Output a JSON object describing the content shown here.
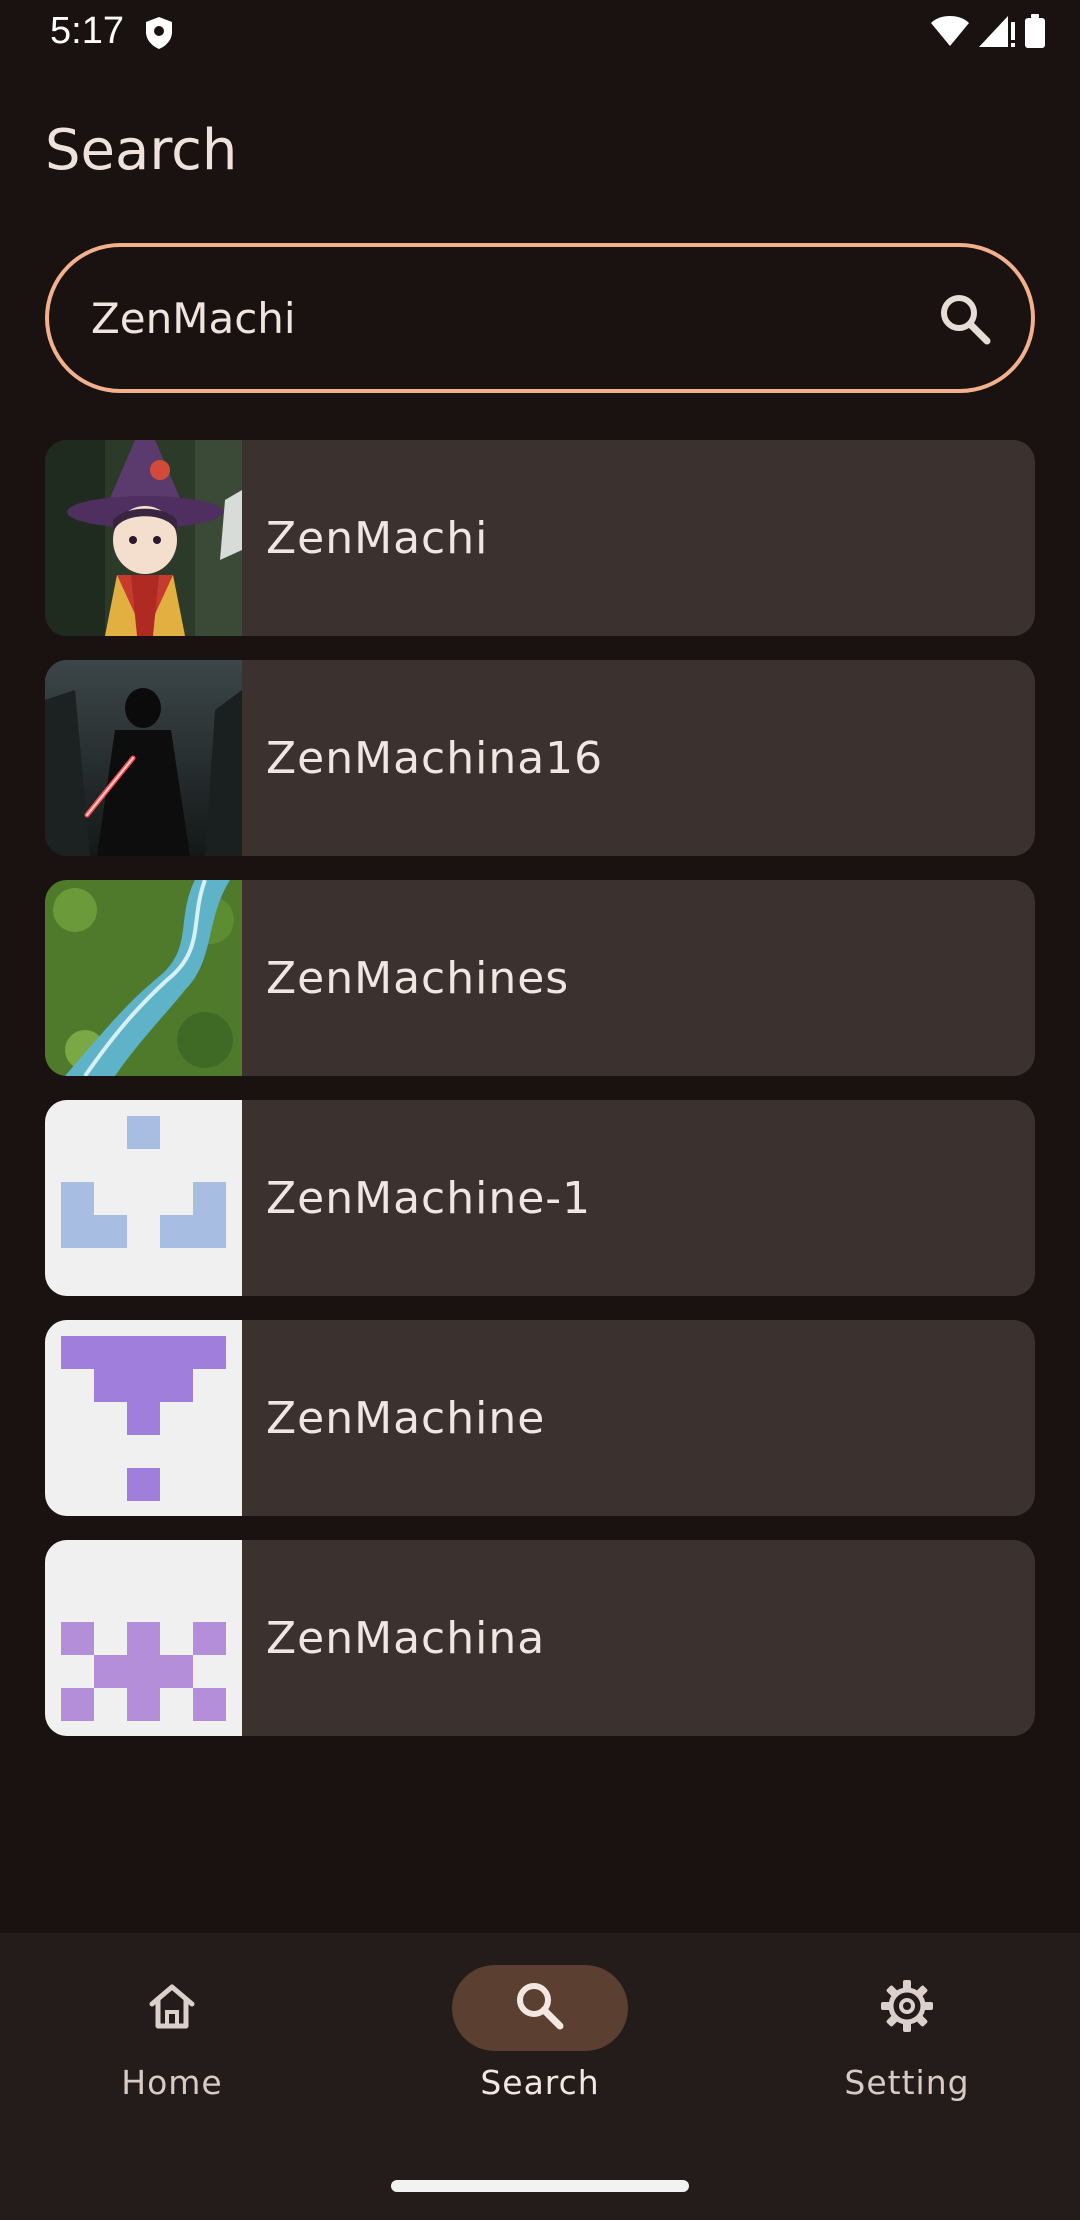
{
  "status_bar": {
    "time": "5:17",
    "icons": [
      "shield-icon",
      "wifi-icon",
      "signal-icon",
      "battery-icon"
    ]
  },
  "page": {
    "title": "Search"
  },
  "search": {
    "value": "ZenMachi",
    "icon": "search-icon",
    "border_color": "#f2b18c"
  },
  "results": [
    {
      "name": "ZenMachi",
      "thumb": "avatar-anime-witch"
    },
    {
      "name": "ZenMachina16",
      "thumb": "avatar-dark-figure-red-saber"
    },
    {
      "name": "ZenMachines",
      "thumb": "avatar-river-aerial"
    },
    {
      "name": "ZenMachine-1",
      "thumb": "identicon-blue"
    },
    {
      "name": "ZenMachine",
      "thumb": "identicon-purple"
    },
    {
      "name": "ZenMachina",
      "thumb": "identicon-lilac"
    }
  ],
  "bottom_nav": {
    "items": [
      {
        "label": "Home",
        "icon": "home-icon"
      },
      {
        "label": "Search",
        "icon": "search-icon",
        "active": true
      },
      {
        "label": "Setting",
        "icon": "gear-icon"
      }
    ],
    "active_color": "#5b3f30"
  }
}
